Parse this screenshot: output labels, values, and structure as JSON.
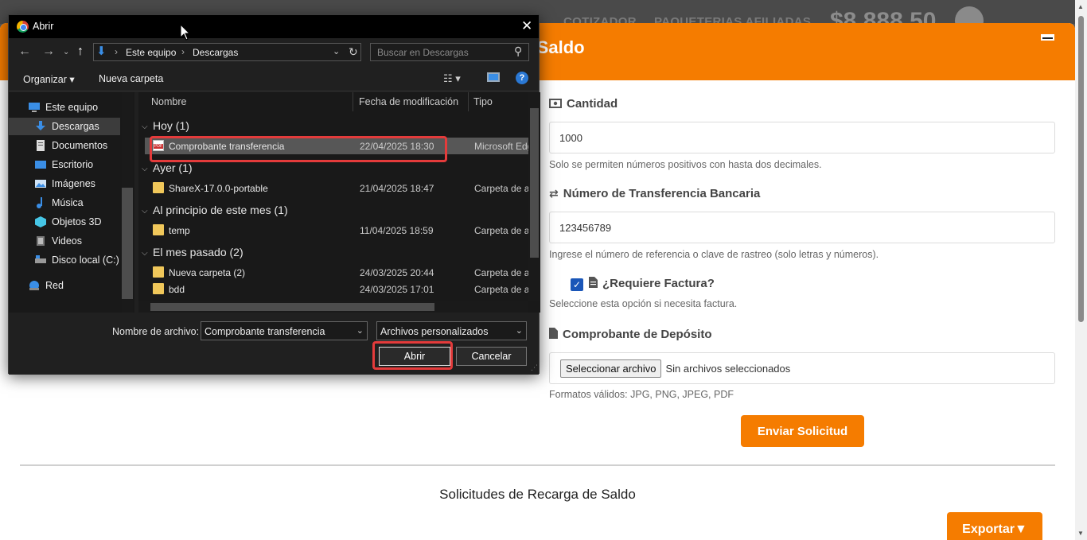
{
  "background_nav": {
    "items": [
      "COTIZADOR",
      "PAQUETERIAS AFILIADAS"
    ],
    "balance": "$8,888.50"
  },
  "modal": {
    "title": "r Saldo",
    "cantidad": {
      "label": "Cantidad",
      "value": "1000",
      "help": "Solo se permiten números positivos con hasta dos decimales."
    },
    "transferencia": {
      "label": "Número de Transferencia Bancaria",
      "value": "123456789",
      "help": "Ingrese el número de referencia o clave de rastreo (solo letras y números)."
    },
    "factura": {
      "label": "¿Requiere Factura?",
      "checked": true,
      "help": "Seleccione esta opción si necesita factura."
    },
    "comprobante": {
      "label": "Comprobante de Depósito",
      "button": "Seleccionar archivo",
      "status": "Sin archivos seleccionados",
      "help": "Formatos válidos: JPG, PNG, JPEG, PDF"
    },
    "submit": "Enviar Solicitud",
    "section_title": "Solicitudes de Recarga de Saldo",
    "export": "Exportar▼"
  },
  "dialog": {
    "title": "Abrir",
    "path": [
      "Este equipo",
      "Descargas"
    ],
    "search_placeholder": "Buscar en Descargas",
    "toolbar": {
      "organize": "Organizar ▾",
      "new_folder": "Nueva carpeta"
    },
    "nav_items": [
      {
        "label": "Este equipo",
        "icon": "pc-icon"
      },
      {
        "label": "Descargas",
        "icon": "download-icon",
        "selected": true
      },
      {
        "label": "Documentos",
        "icon": "document-icon"
      },
      {
        "label": "Escritorio",
        "icon": "desktop-icon"
      },
      {
        "label": "Imágenes",
        "icon": "image-icon"
      },
      {
        "label": "Música",
        "icon": "music-icon"
      },
      {
        "label": "Objetos 3D",
        "icon": "cube-icon"
      },
      {
        "label": "Videos",
        "icon": "video-icon"
      },
      {
        "label": "Disco local (C:)",
        "icon": "disk-icon"
      },
      {
        "label": "Red",
        "icon": "network-icon"
      }
    ],
    "columns": [
      "Nombre",
      "Fecha de modificación",
      "Tipo"
    ],
    "groups": [
      {
        "label": "Hoy (1)",
        "files": [
          {
            "name": "Comprobante transferencia",
            "date": "22/04/2025 18:30",
            "type": "Microsoft Edge PDF",
            "icon": "pdf-icon",
            "selected": true
          }
        ]
      },
      {
        "label": "Ayer (1)",
        "files": [
          {
            "name": "ShareX-17.0.0-portable",
            "date": "21/04/2025 18:47",
            "type": "Carpeta de archivos",
            "icon": "folder-icon"
          }
        ]
      },
      {
        "label": "Al principio de este mes (1)",
        "files": [
          {
            "name": "temp",
            "date": "11/04/2025 18:59",
            "type": "Carpeta de archivos",
            "icon": "folder-icon"
          }
        ]
      },
      {
        "label": "El mes pasado (2)",
        "files": [
          {
            "name": "Nueva carpeta (2)",
            "date": "24/03/2025 20:44",
            "type": "Carpeta de archivos",
            "icon": "folder-icon"
          },
          {
            "name": "bdd",
            "date": "24/03/2025 17:01",
            "type": "Carpeta de archivos",
            "icon": "folder-icon"
          }
        ]
      }
    ],
    "filename_label": "Nombre de archivo:",
    "filename_value": "Comprobante transferencia",
    "filetype": "Archivos personalizados",
    "open_button": "Abrir",
    "cancel_button": "Cancelar"
  },
  "colors": {
    "accent": "#f57c00",
    "highlight": "#e43b3b",
    "checkbox": "#1a56b8"
  }
}
